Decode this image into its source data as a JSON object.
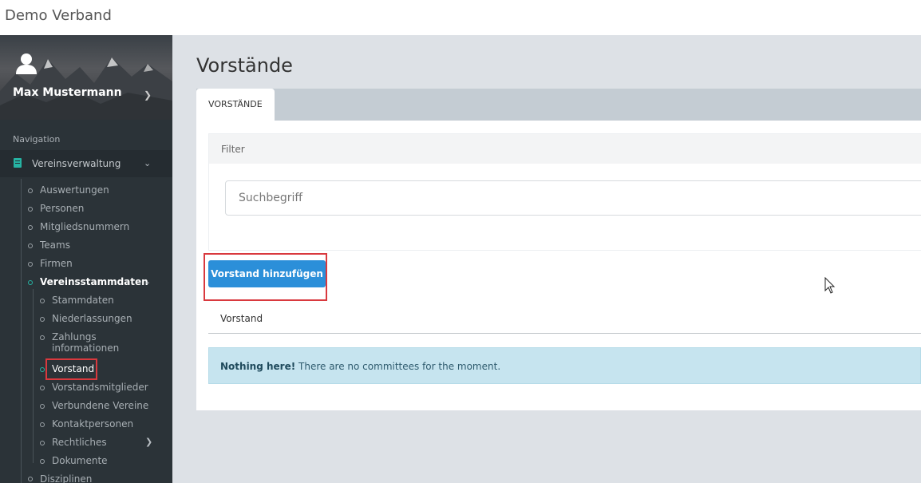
{
  "app": {
    "title": "Demo Verband"
  },
  "user": {
    "name": "Max Mustermann"
  },
  "sidebar": {
    "heading": "Navigation",
    "section": "Vereinsverwaltung",
    "items": [
      "Auswertungen",
      "Personen",
      "Mitgliedsnummern",
      "Teams",
      "Firmen"
    ],
    "group": {
      "label": "Vereinsstammdaten",
      "children": [
        "Stammdaten",
        "Niederlassungen",
        "Zahlungs",
        "informationen",
        "Vorstand",
        "Vorstandsmitglieder",
        "Verbundene Vereine",
        "Kontaktpersonen",
        "Rechtliches",
        "Dokumente"
      ]
    },
    "after": "Disziplinen"
  },
  "main": {
    "title": "Vorstände",
    "tab": "VORSTÄNDE",
    "filter": {
      "label": "Filter",
      "placeholder": "Suchbegriff"
    },
    "add_button": "Vorstand hinzufügen",
    "column": "Vorstand",
    "alert": {
      "strong": "Nothing here!",
      "text": " There are no committees for the moment."
    }
  },
  "colors": {
    "accent": "#26b3a3",
    "primary_button": "#2b8fd9",
    "highlight": "#d9393e",
    "sidebar": "#2b3338",
    "alert": "#c6e4ef"
  }
}
